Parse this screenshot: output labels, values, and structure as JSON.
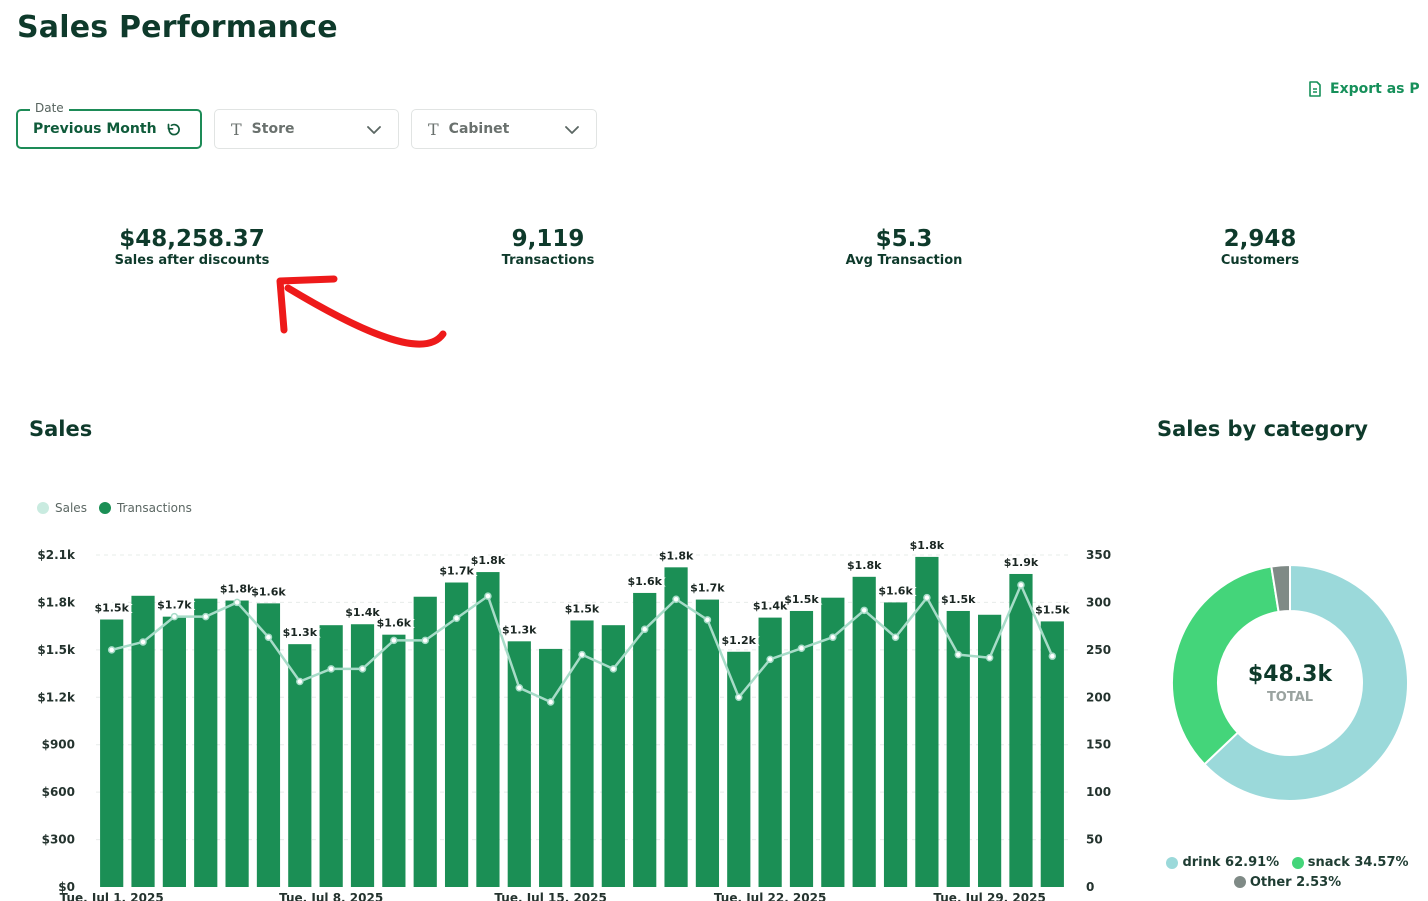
{
  "header": {
    "title": "Sales Performance",
    "export_label": "Export as P"
  },
  "filters": {
    "date": {
      "legend": "Date",
      "value": "Previous Month"
    },
    "store": {
      "placeholder": "Store"
    },
    "cabinet": {
      "placeholder": "Cabinet"
    }
  },
  "kpis": [
    {
      "value": "$48,258.37",
      "label": "Sales after discounts"
    },
    {
      "value": "9,119",
      "label": "Transactions"
    },
    {
      "value": "$5.3",
      "label": "Avg Transaction"
    },
    {
      "value": "2,948",
      "label": "Customers"
    }
  ],
  "sales_section": {
    "title": "Sales",
    "legend": [
      "Sales",
      "Transactions"
    ]
  },
  "category_section": {
    "title": "Sales by category",
    "total_value": "$48.3k",
    "total_label": "TOTAL",
    "legend": [
      {
        "label": "drink 62.91%",
        "color": "#9bd9da"
      },
      {
        "label": "snack 34.57%",
        "color": "#44d57a"
      },
      {
        "label": "Other 2.53%",
        "color": "#7f8a86"
      }
    ]
  },
  "colors": {
    "bar": "#1b8f55",
    "line": "#a7dcc8",
    "accent": "#1d8b57"
  },
  "chart_data": [
    {
      "type": "bar",
      "title": "Sales",
      "y_left": {
        "ticks": [
          "$0",
          "$300",
          "$600",
          "$900",
          "$1.2k",
          "$1.5k",
          "$1.8k",
          "$2.1k"
        ],
        "ylim": [
          0,
          2100
        ]
      },
      "y_right": {
        "ticks": [
          "0",
          "50",
          "100",
          "150",
          "200",
          "250",
          "300",
          "350"
        ],
        "ylim": [
          0,
          350
        ]
      },
      "x_ticks": [
        "Tue, Jul 1, 2025",
        "Tue, Jul 8, 2025",
        "Tue, Jul 15, 2025",
        "Tue, Jul 22, 2025",
        "Tue, Jul 29, 2025"
      ],
      "series": [
        {
          "name": "Transactions",
          "kind": "bar",
          "axis": "right",
          "values": [
            282,
            307,
            285,
            304,
            302,
            299,
            256,
            276,
            277,
            266,
            306,
            321,
            332,
            259,
            251,
            281,
            276,
            310,
            337,
            303,
            248,
            284,
            291,
            305,
            327,
            300,
            348,
            291,
            287,
            330,
            280
          ]
        },
        {
          "name": "Sales",
          "kind": "line",
          "axis": "left",
          "values": [
            1500,
            1550,
            1710,
            1710,
            1800,
            1580,
            1300,
            1380,
            1380,
            1560,
            1560,
            1700,
            1840,
            1260,
            1170,
            1470,
            1380,
            1630,
            1820,
            1690,
            1200,
            1440,
            1510,
            1580,
            1750,
            1580,
            1830,
            1470,
            1450,
            1910,
            1460
          ]
        }
      ],
      "data_labels": [
        "$1.5k",
        "",
        "$1.7k",
        "",
        "$1.8k",
        "$1.6k",
        "$1.3k",
        "",
        "$1.4k",
        "$1.6k",
        "",
        "$1.7k",
        "$1.8k",
        "$1.3k",
        "",
        "$1.5k",
        "",
        "$1.6k",
        "$1.8k",
        "$1.7k",
        "$1.2k",
        "$1.4k",
        "$1.5k",
        "",
        "$1.8k",
        "$1.6k",
        "$1.8k",
        "$1.5k",
        "",
        "$1.9k",
        "$1.5k"
      ]
    },
    {
      "type": "pie",
      "title": "Sales by category",
      "labels": [
        "drink",
        "snack",
        "Other"
      ],
      "values": [
        62.91,
        34.57,
        2.53
      ]
    }
  ]
}
